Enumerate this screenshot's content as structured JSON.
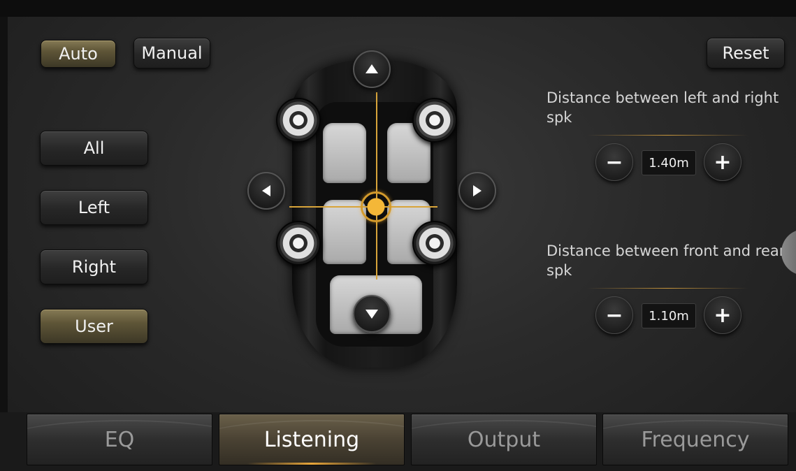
{
  "mode": {
    "auto_label": "Auto",
    "manual_label": "Manual",
    "reset_label": "Reset"
  },
  "presets": [
    {
      "label": "All"
    },
    {
      "label": "Left"
    },
    {
      "label": "Right"
    },
    {
      "label": "User"
    }
  ],
  "balance": {
    "lr_label": "Distance between left and right spk",
    "lr_value": "1.40m",
    "fr_label": "Distance between front and rear spk",
    "fr_value": "1.10m",
    "minus": "−",
    "plus": "+"
  },
  "tabs": [
    {
      "label": "EQ"
    },
    {
      "label": "Listening"
    },
    {
      "label": "Output"
    },
    {
      "label": "Frequency"
    }
  ],
  "colors": {
    "accent": "#d8a43a",
    "active_button": "#5e5537"
  },
  "icons": [
    "arrow-up-icon",
    "arrow-down-icon",
    "arrow-left-icon",
    "arrow-right-icon",
    "speaker-icon",
    "listening-position-icon"
  ]
}
